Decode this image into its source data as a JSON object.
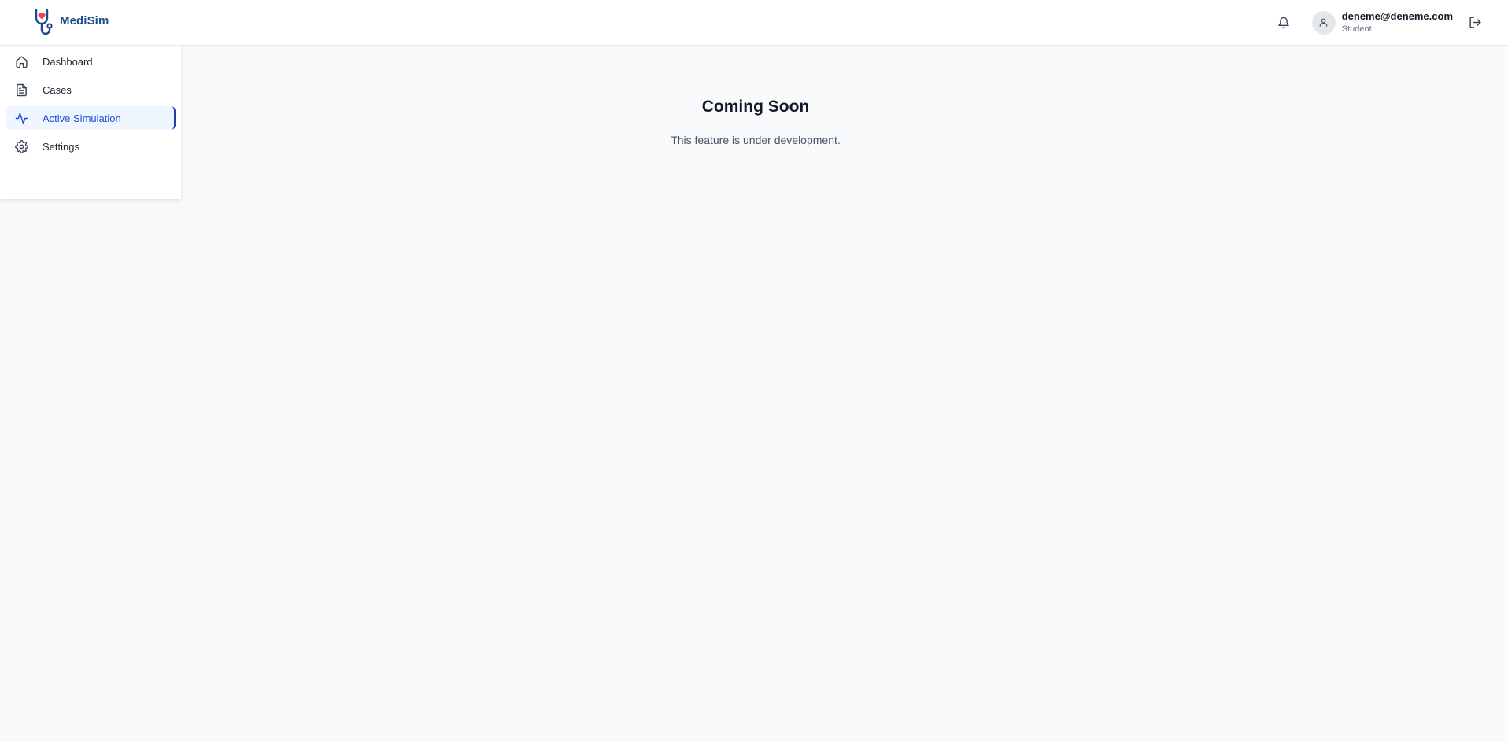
{
  "brand": {
    "name": "MediSim",
    "logo_icon": "stethoscope-heart-icon",
    "colors": {
      "primary": "#1e4a8c",
      "heart": "#ef4444"
    }
  },
  "header": {
    "notification_icon": "bell-icon",
    "user": {
      "email": "deneme@deneme.com",
      "role": "Student",
      "avatar_icon": "user-icon"
    },
    "logout_icon": "logout-icon"
  },
  "sidebar": {
    "items": [
      {
        "label": "Dashboard",
        "icon": "home-icon",
        "active": false
      },
      {
        "label": "Cases",
        "icon": "file-text-icon",
        "active": false
      },
      {
        "label": "Active Simulation",
        "icon": "activity-icon",
        "active": true
      },
      {
        "label": "Settings",
        "icon": "gear-icon",
        "active": false
      }
    ],
    "active_color": "#1d4ed8",
    "active_bg": "#eff6ff"
  },
  "main": {
    "title": "Coming Soon",
    "subtitle": "This feature is under development."
  }
}
